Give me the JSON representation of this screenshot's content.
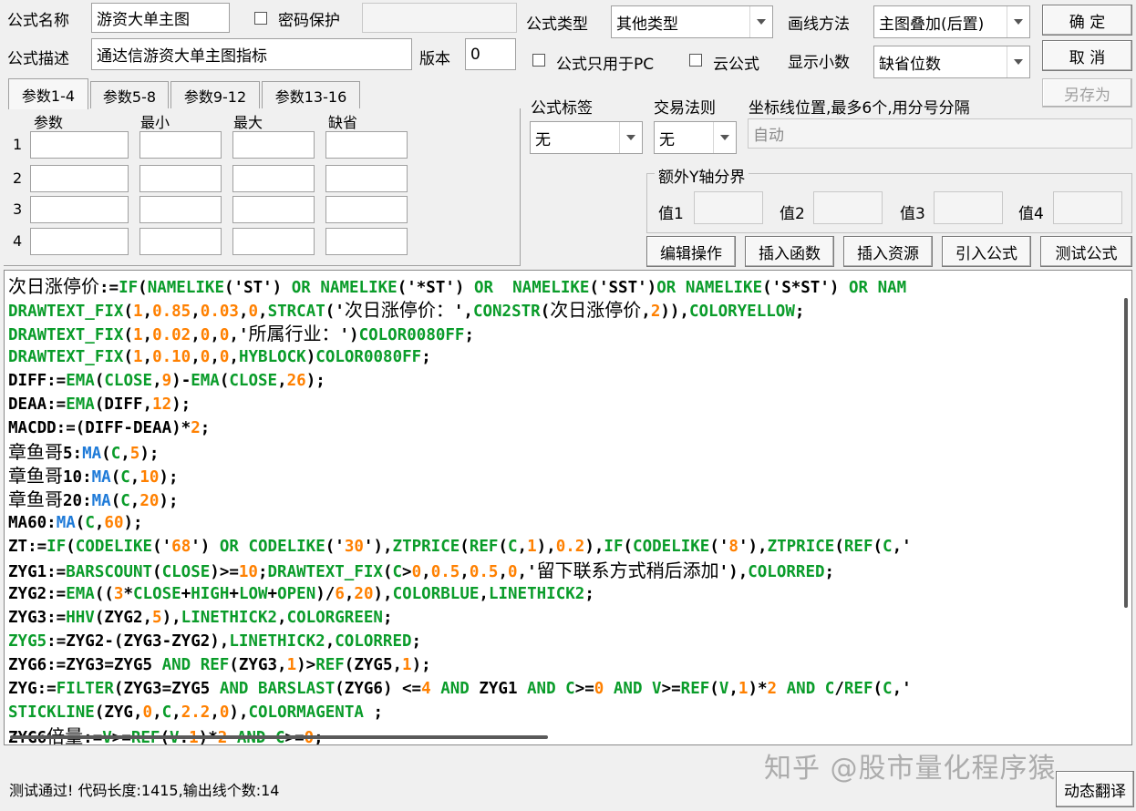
{
  "header": {
    "formula_name_label": "公式名称",
    "formula_name_value": "游资大单主图",
    "password_label": "密码保护",
    "formula_desc_label": "公式描述",
    "formula_desc_value": "通达信游资大单主图指标",
    "version_label": "版本",
    "version_value": "0",
    "formula_type_label": "公式类型",
    "formula_type_value": "其他类型",
    "draw_method_label": "画线方法",
    "draw_method_value": "主图叠加(后置)",
    "pc_only_label": "公式只用于PC",
    "cloud_label": "云公式",
    "decimals_label": "显示小数",
    "decimals_value": "缺省位数",
    "tag_label": "公式标签",
    "tag_value": "无",
    "trade_rule_label": "交易法则",
    "trade_rule_value": "无",
    "coord_label": "坐标线位置,最多6个,用分号分隔",
    "coord_value": "自动",
    "extra_y_label": "额外Y轴分界",
    "val1_label": "值1",
    "val2_label": "值2",
    "val3_label": "值3",
    "val4_label": "值4"
  },
  "buttons": {
    "ok": "确  定",
    "cancel": "取  消",
    "save_as": "另存为",
    "edit_ops": "编辑操作",
    "insert_func": "插入函数",
    "insert_res": "插入资源",
    "import_formula": "引入公式",
    "test_formula": "测试公式",
    "dynamic_translate": "动态翻译"
  },
  "tabs": [
    "参数1-4",
    "参数5-8",
    "参数9-12",
    "参数13-16"
  ],
  "params": {
    "columns": [
      "参数",
      "最小",
      "最大",
      "缺省"
    ],
    "rows": [
      "1",
      "2",
      "3",
      "4"
    ]
  },
  "code_lines": [
    [
      [
        "c-cn",
        "次日涨停价"
      ],
      [
        "c-b",
        ":="
      ],
      [
        "c-g",
        "IF"
      ],
      [
        "c-b",
        "("
      ],
      [
        "c-g",
        "NAMELIKE"
      ],
      [
        "c-b",
        "('ST') "
      ],
      [
        "c-g",
        "OR"
      ],
      [
        "c-b",
        " "
      ],
      [
        "c-g",
        "NAMELIKE"
      ],
      [
        "c-b",
        "('*ST') "
      ],
      [
        "c-g",
        "OR"
      ],
      [
        "c-b",
        "  "
      ],
      [
        "c-g",
        "NAMELIKE"
      ],
      [
        "c-b",
        "('SST')"
      ],
      [
        "c-g",
        "OR"
      ],
      [
        "c-b",
        " "
      ],
      [
        "c-g",
        "NAMELIKE"
      ],
      [
        "c-b",
        "('S*ST') "
      ],
      [
        "c-g",
        "OR"
      ],
      [
        "c-b",
        " "
      ],
      [
        "c-g",
        "NAM"
      ]
    ],
    [
      [
        "c-g",
        "DRAWTEXT_FIX"
      ],
      [
        "c-b",
        "("
      ],
      [
        "c-o",
        "1"
      ],
      [
        "c-b",
        ","
      ],
      [
        "c-o",
        "0.85"
      ],
      [
        "c-b",
        ","
      ],
      [
        "c-o",
        "0.03"
      ],
      [
        "c-b",
        ","
      ],
      [
        "c-o",
        "0"
      ],
      [
        "c-b",
        ","
      ],
      [
        "c-g",
        "STRCAT"
      ],
      [
        "c-b",
        "('"
      ],
      [
        "c-cn",
        "次日涨停价："
      ],
      [
        "c-b",
        "',"
      ],
      [
        "c-g",
        "CON2STR"
      ],
      [
        "c-b",
        "("
      ],
      [
        "c-cn",
        "次日涨停价"
      ],
      [
        "c-b",
        ","
      ],
      [
        "c-o",
        "2"
      ],
      [
        "c-b",
        ")),"
      ],
      [
        "c-g",
        "COLORYELLOW"
      ],
      [
        "c-b",
        ";"
      ]
    ],
    [
      [
        "c-g",
        "DRAWTEXT_FIX"
      ],
      [
        "c-b",
        "("
      ],
      [
        "c-o",
        "1"
      ],
      [
        "c-b",
        ","
      ],
      [
        "c-o",
        "0.02"
      ],
      [
        "c-b",
        ","
      ],
      [
        "c-o",
        "0"
      ],
      [
        "c-b",
        ","
      ],
      [
        "c-o",
        "0"
      ],
      [
        "c-b",
        ",'"
      ],
      [
        "c-cn",
        "所属行业："
      ],
      [
        "c-b",
        "')"
      ],
      [
        "c-g",
        "COLOR0080FF"
      ],
      [
        "c-b",
        ";"
      ]
    ],
    [
      [
        "c-g",
        "DRAWTEXT_FIX"
      ],
      [
        "c-b",
        "("
      ],
      [
        "c-o",
        "1"
      ],
      [
        "c-b",
        ","
      ],
      [
        "c-o",
        "0.10"
      ],
      [
        "c-b",
        ","
      ],
      [
        "c-o",
        "0"
      ],
      [
        "c-b",
        ","
      ],
      [
        "c-o",
        "0"
      ],
      [
        "c-b",
        ","
      ],
      [
        "c-g",
        "HYBLOCK"
      ],
      [
        "c-b",
        ")"
      ],
      [
        "c-g",
        "COLOR0080FF"
      ],
      [
        "c-b",
        ";"
      ]
    ],
    [
      [
        "c-b",
        "DIFF:="
      ],
      [
        "c-g",
        "EMA"
      ],
      [
        "c-b",
        "("
      ],
      [
        "c-g",
        "CLOSE"
      ],
      [
        "c-b",
        ","
      ],
      [
        "c-o",
        "9"
      ],
      [
        "c-b",
        ")-"
      ],
      [
        "c-g",
        "EMA"
      ],
      [
        "c-b",
        "("
      ],
      [
        "c-g",
        "CLOSE"
      ],
      [
        "c-b",
        ","
      ],
      [
        "c-o",
        "26"
      ],
      [
        "c-b",
        ");"
      ]
    ],
    [
      [
        "c-b",
        "DEAA:="
      ],
      [
        "c-g",
        "EMA"
      ],
      [
        "c-b",
        "(DIFF,"
      ],
      [
        "c-o",
        "12"
      ],
      [
        "c-b",
        ");"
      ]
    ],
    [
      [
        "c-b",
        "MACDD:=(DIFF-DEAA)*"
      ],
      [
        "c-o",
        "2"
      ],
      [
        "c-b",
        ";"
      ]
    ],
    [
      [
        "c-cn",
        "章鱼哥"
      ],
      [
        "c-b",
        "5:"
      ],
      [
        "c-bl",
        "MA"
      ],
      [
        "c-b",
        "("
      ],
      [
        "c-g",
        "C"
      ],
      [
        "c-b",
        ","
      ],
      [
        "c-o",
        "5"
      ],
      [
        "c-b",
        ");"
      ]
    ],
    [
      [
        "c-cn",
        "章鱼哥"
      ],
      [
        "c-b",
        "10:"
      ],
      [
        "c-bl",
        "MA"
      ],
      [
        "c-b",
        "("
      ],
      [
        "c-g",
        "C"
      ],
      [
        "c-b",
        ","
      ],
      [
        "c-o",
        "10"
      ],
      [
        "c-b",
        ");"
      ]
    ],
    [
      [
        "c-cn",
        "章鱼哥"
      ],
      [
        "c-b",
        "20:"
      ],
      [
        "c-bl",
        "MA"
      ],
      [
        "c-b",
        "("
      ],
      [
        "c-g",
        "C"
      ],
      [
        "c-b",
        ","
      ],
      [
        "c-o",
        "20"
      ],
      [
        "c-b",
        ");"
      ]
    ],
    [
      [
        "c-b",
        "MA60:"
      ],
      [
        "c-bl",
        "MA"
      ],
      [
        "c-b",
        "("
      ],
      [
        "c-g",
        "C"
      ],
      [
        "c-b",
        ","
      ],
      [
        "c-o",
        "60"
      ],
      [
        "c-b",
        ");"
      ]
    ],
    [
      [
        "c-b",
        "ZT:="
      ],
      [
        "c-g",
        "IF"
      ],
      [
        "c-b",
        "("
      ],
      [
        "c-g",
        "CODELIKE"
      ],
      [
        "c-b",
        "('"
      ],
      [
        "c-o",
        "68"
      ],
      [
        "c-b",
        "') "
      ],
      [
        "c-g",
        "OR"
      ],
      [
        "c-b",
        " "
      ],
      [
        "c-g",
        "CODELIKE"
      ],
      [
        "c-b",
        "('"
      ],
      [
        "c-o",
        "30"
      ],
      [
        "c-b",
        "'),"
      ],
      [
        "c-g",
        "ZTPRICE"
      ],
      [
        "c-b",
        "("
      ],
      [
        "c-g",
        "REF"
      ],
      [
        "c-b",
        "("
      ],
      [
        "c-g",
        "C"
      ],
      [
        "c-b",
        ","
      ],
      [
        "c-o",
        "1"
      ],
      [
        "c-b",
        "),"
      ],
      [
        "c-o",
        "0.2"
      ],
      [
        "c-b",
        "),"
      ],
      [
        "c-g",
        "IF"
      ],
      [
        "c-b",
        "("
      ],
      [
        "c-g",
        "CODELIKE"
      ],
      [
        "c-b",
        "('"
      ],
      [
        "c-o",
        "8"
      ],
      [
        "c-b",
        "'),"
      ],
      [
        "c-g",
        "ZTPRICE"
      ],
      [
        "c-b",
        "("
      ],
      [
        "c-g",
        "REF"
      ],
      [
        "c-b",
        "("
      ],
      [
        "c-g",
        "C"
      ],
      [
        "c-b",
        ",'"
      ]
    ],
    [
      [
        "c-b",
        "ZYG1:="
      ],
      [
        "c-g",
        "BARSCOUNT"
      ],
      [
        "c-b",
        "("
      ],
      [
        "c-g",
        "CLOSE"
      ],
      [
        "c-b",
        ")>="
      ],
      [
        "c-o",
        "10"
      ],
      [
        "c-b",
        ";"
      ],
      [
        "c-g",
        "DRAWTEXT_FIX"
      ],
      [
        "c-b",
        "("
      ],
      [
        "c-g",
        "C"
      ],
      [
        "c-b",
        ">"
      ],
      [
        "c-o",
        "0"
      ],
      [
        "c-b",
        ","
      ],
      [
        "c-o",
        "0.5"
      ],
      [
        "c-b",
        ","
      ],
      [
        "c-o",
        "0.5"
      ],
      [
        "c-b",
        ","
      ],
      [
        "c-o",
        "0"
      ],
      [
        "c-b",
        ",'"
      ],
      [
        "c-cn",
        "留下联系方式稍后添加"
      ],
      [
        "c-b",
        "'),"
      ],
      [
        "c-g",
        "COLORRED"
      ],
      [
        "c-b",
        ";"
      ]
    ],
    [
      [
        "c-b",
        "ZYG2:="
      ],
      [
        "c-g",
        "EMA"
      ],
      [
        "c-b",
        "(("
      ],
      [
        "c-o",
        "3"
      ],
      [
        "c-b",
        "*"
      ],
      [
        "c-g",
        "CLOSE"
      ],
      [
        "c-b",
        "+"
      ],
      [
        "c-g",
        "HIGH"
      ],
      [
        "c-b",
        "+"
      ],
      [
        "c-g",
        "LOW"
      ],
      [
        "c-b",
        "+"
      ],
      [
        "c-g",
        "OPEN"
      ],
      [
        "c-b",
        ")/"
      ],
      [
        "c-o",
        "6"
      ],
      [
        "c-b",
        ","
      ],
      [
        "c-o",
        "20"
      ],
      [
        "c-b",
        "),"
      ],
      [
        "c-g",
        "COLORBLUE"
      ],
      [
        "c-b",
        ","
      ],
      [
        "c-g",
        "LINETHICK2"
      ],
      [
        "c-b",
        ";"
      ]
    ],
    [
      [
        "c-b",
        "ZYG3:="
      ],
      [
        "c-g",
        "HHV"
      ],
      [
        "c-b",
        "(ZYG2,"
      ],
      [
        "c-o",
        "5"
      ],
      [
        "c-b",
        "),"
      ],
      [
        "c-g",
        "LINETHICK2"
      ],
      [
        "c-b",
        ","
      ],
      [
        "c-g",
        "COLORGREEN"
      ],
      [
        "c-b",
        ";"
      ]
    ],
    [
      [
        "c-g",
        "ZYG5"
      ],
      [
        "c-b",
        ":=ZYG2-(ZYG3-ZYG2),"
      ],
      [
        "c-g",
        "LINETHICK2"
      ],
      [
        "c-b",
        ","
      ],
      [
        "c-g",
        "COLORRED"
      ],
      [
        "c-b",
        ";"
      ]
    ],
    [
      [
        "c-b",
        "ZYG6:=ZYG3=ZYG5 "
      ],
      [
        "c-g",
        "AND"
      ],
      [
        "c-b",
        " "
      ],
      [
        "c-g",
        "REF"
      ],
      [
        "c-b",
        "(ZYG3,"
      ],
      [
        "c-o",
        "1"
      ],
      [
        "c-b",
        ")>"
      ],
      [
        "c-g",
        "REF"
      ],
      [
        "c-b",
        "(ZYG5,"
      ],
      [
        "c-o",
        "1"
      ],
      [
        "c-b",
        ");"
      ]
    ],
    [
      [
        "c-b",
        "ZYG:="
      ],
      [
        "c-g",
        "FILTER"
      ],
      [
        "c-b",
        "(ZYG3=ZYG5 "
      ],
      [
        "c-g",
        "AND"
      ],
      [
        "c-b",
        " "
      ],
      [
        "c-g",
        "BARSLAST"
      ],
      [
        "c-b",
        "(ZYG6) <="
      ],
      [
        "c-o",
        "4"
      ],
      [
        "c-b",
        " "
      ],
      [
        "c-g",
        "AND"
      ],
      [
        "c-b",
        " ZYG1 "
      ],
      [
        "c-g",
        "AND"
      ],
      [
        "c-b",
        " "
      ],
      [
        "c-g",
        "C"
      ],
      [
        "c-b",
        ">="
      ],
      [
        "c-o",
        "0"
      ],
      [
        "c-b",
        " "
      ],
      [
        "c-g",
        "AND"
      ],
      [
        "c-b",
        " "
      ],
      [
        "c-g",
        "V"
      ],
      [
        "c-b",
        ">="
      ],
      [
        "c-g",
        "REF"
      ],
      [
        "c-b",
        "("
      ],
      [
        "c-g",
        "V"
      ],
      [
        "c-b",
        ","
      ],
      [
        "c-o",
        "1"
      ],
      [
        "c-b",
        ")*"
      ],
      [
        "c-o",
        "2"
      ],
      [
        "c-b",
        " "
      ],
      [
        "c-g",
        "AND"
      ],
      [
        "c-b",
        " "
      ],
      [
        "c-g",
        "C"
      ],
      [
        "c-b",
        "/"
      ],
      [
        "c-g",
        "REF"
      ],
      [
        "c-b",
        "("
      ],
      [
        "c-g",
        "C"
      ],
      [
        "c-b",
        ",'"
      ]
    ],
    [
      [
        "c-g",
        "STICKLINE"
      ],
      [
        "c-b",
        "(ZYG,"
      ],
      [
        "c-o",
        "0"
      ],
      [
        "c-b",
        ","
      ],
      [
        "c-g",
        "C"
      ],
      [
        "c-b",
        ","
      ],
      [
        "c-o",
        "2.2"
      ],
      [
        "c-b",
        ","
      ],
      [
        "c-o",
        "0"
      ],
      [
        "c-b",
        "),"
      ],
      [
        "c-g",
        "COLORMAGENTA"
      ],
      [
        "c-b",
        " ;"
      ]
    ],
    [
      [
        "c-b",
        "ZYG6"
      ],
      [
        "c-cn",
        "倍量"
      ],
      [
        "c-b",
        ":="
      ],
      [
        "c-g",
        "V"
      ],
      [
        "c-b",
        ">="
      ],
      [
        "c-g",
        "REF"
      ],
      [
        "c-b",
        "("
      ],
      [
        "c-g",
        "V"
      ],
      [
        "c-b",
        "."
      ],
      [
        "c-o",
        "1"
      ],
      [
        "c-b",
        ")*"
      ],
      [
        "c-o",
        "2"
      ],
      [
        "c-b",
        " "
      ],
      [
        "c-g",
        "AND"
      ],
      [
        "c-b",
        " "
      ],
      [
        "c-g",
        "C"
      ],
      [
        "c-b",
        ">="
      ],
      [
        "c-o",
        "0"
      ],
      [
        "c-b",
        ";"
      ]
    ]
  ],
  "status": {
    "text": "测试通过! 代码长度:1415,输出线个数:14"
  },
  "watermark": "知乎 @股市量化程序猿"
}
